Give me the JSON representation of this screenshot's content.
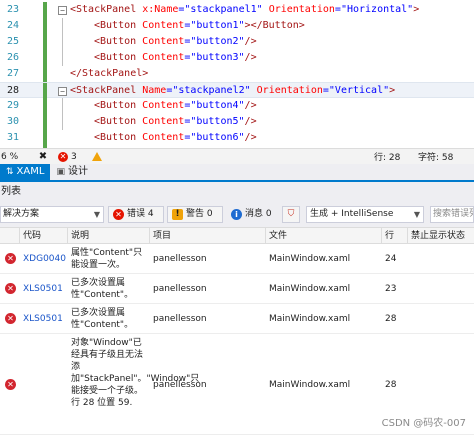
{
  "editor": {
    "lines": [
      {
        "num": "23",
        "parts": [
          [
            "tag",
            "<StackPanel "
          ],
          [
            "attr",
            "x:Name"
          ],
          [
            "val",
            "=\"stackpanel1\" "
          ],
          [
            "attr",
            "Orientation"
          ],
          [
            "val",
            "=\"Horizontal\""
          ],
          [
            "tag",
            ">"
          ]
        ]
      },
      {
        "num": "24",
        "parts": [
          [
            "tag",
            "<Button "
          ],
          [
            "attr",
            "Content"
          ],
          [
            "val",
            "=\"button1\""
          ],
          [
            "tag",
            "></Button>"
          ]
        ]
      },
      {
        "num": "25",
        "parts": [
          [
            "tag",
            "<Button "
          ],
          [
            "attr",
            "Content"
          ],
          [
            "val",
            "=\"button2\""
          ],
          [
            "tag",
            "/>"
          ]
        ]
      },
      {
        "num": "26",
        "parts": [
          [
            "tag",
            "<Button "
          ],
          [
            "attr",
            "Content"
          ],
          [
            "val",
            "=\"button3\""
          ],
          [
            "tag",
            "/>"
          ]
        ]
      },
      {
        "num": "27",
        "parts": [
          [
            "tag",
            "</StackPanel>"
          ]
        ]
      },
      {
        "num": "28",
        "parts": [
          [
            "tag",
            "<StackPanel "
          ],
          [
            "attr",
            "Name"
          ],
          [
            "val",
            "=\"stackpanel2\" "
          ],
          [
            "attr",
            "Orientation"
          ],
          [
            "val",
            "=\"Vertical\""
          ],
          [
            "tag",
            ">"
          ]
        ]
      },
      {
        "num": "29",
        "parts": [
          [
            "tag",
            "<Button "
          ],
          [
            "attr",
            "Content"
          ],
          [
            "val",
            "=\"button4\""
          ],
          [
            "tag",
            "/>"
          ]
        ]
      },
      {
        "num": "30",
        "parts": [
          [
            "tag",
            "<Button "
          ],
          [
            "attr",
            "Content"
          ],
          [
            "val",
            "=\"button5\""
          ],
          [
            "tag",
            "/>"
          ]
        ]
      },
      {
        "num": "31",
        "parts": [
          [
            "tag",
            "<Button "
          ],
          [
            "attr",
            "Content"
          ],
          [
            "val",
            "=\"button6\""
          ],
          [
            "tag",
            "/>"
          ]
        ]
      },
      {
        "num": "32",
        "parts": [
          [
            "tag",
            "</StackPanel>"
          ]
        ]
      }
    ]
  },
  "editor_status": {
    "zoom": "6 %",
    "error_count": "3",
    "line_label": "行: 28",
    "char_label": "字符: 58"
  },
  "tabs": {
    "design": "设计",
    "xaml": "XAML"
  },
  "error_list": {
    "title": "列表",
    "scope_dropdown": "解决方案",
    "errors_filter": "错误 4",
    "warnings_filter": "警告 0",
    "messages_filter": "消息 0",
    "build_dropdown": "生成 + IntelliSense",
    "search_placeholder": "搜索错误列",
    "headers": {
      "code": "代码",
      "description": "说明",
      "project": "项目",
      "file": "文件",
      "line": "行",
      "suppression": "禁止显示状态"
    },
    "rows": [
      {
        "code": "XDG0040",
        "description": "属性\"Content\"只能设置一次。",
        "project": "panellesson",
        "file": "MainWindow.xaml",
        "line": "24"
      },
      {
        "code": "XLS0501",
        "description": "已多次设置属性\"Content\"。",
        "project": "panellesson",
        "file": "MainWindow.xaml",
        "line": "23"
      },
      {
        "code": "XLS0501",
        "description": "已多次设置属性\"Content\"。",
        "project": "panellesson",
        "file": "MainWindow.xaml",
        "line": "28"
      },
      {
        "code": "",
        "description": "对象\"Window\"已经具有子级且无法添加\"StackPanel\"。\"Window\"只能接受一个子级。 行 28 位置 59.",
        "project": "panellesson",
        "file": "MainWindow.xaml",
        "line": "28"
      }
    ],
    "watermark": "CSDN @码农-007"
  },
  "colors": {
    "accent": "#007acc",
    "error": "#e51400",
    "warning": "#f0a30a",
    "link": "#1a55c9"
  }
}
